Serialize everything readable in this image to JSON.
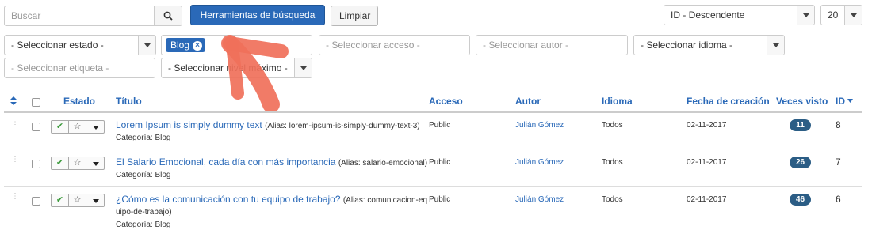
{
  "toolbar": {
    "search_placeholder": "Buscar",
    "search_tools_label": "Herramientas de búsqueda",
    "clear_label": "Limpiar",
    "ordering_value": "ID - Descendente",
    "limit_value": "20"
  },
  "filters": {
    "state_placeholder": "- Seleccionar estado -",
    "category_chip": "Blog",
    "access_placeholder": "- Seleccionar acceso -",
    "author_placeholder": "- Seleccionar autor -",
    "language_placeholder": "- Seleccionar idioma -",
    "tag_placeholder": "- Seleccionar etiqueta -",
    "level_placeholder": "- Seleccionar nivel máximo -"
  },
  "table": {
    "headers": {
      "status": "Estado",
      "title": "Título",
      "access": "Acceso",
      "author": "Autor",
      "language": "Idioma",
      "created": "Fecha de creación",
      "hits": "Veces visto",
      "id": "ID"
    },
    "rows": [
      {
        "title": "Lorem Ipsum is simply dummy text",
        "alias": "(Alias: lorem-ipsum-is-simply-dummy-text-3)",
        "category": "Categoría: Blog",
        "access": "Public",
        "author": "Julián Gómez",
        "language": "Todos",
        "created": "02-11-2017",
        "hits": "11",
        "id": "8"
      },
      {
        "title": "El Salario Emocional, cada día con más importancia",
        "alias": "(Alias: salario-emocional)",
        "category": "Categoría: Blog",
        "access": "Public",
        "author": "Julián Gómez",
        "language": "Todos",
        "created": "02-11-2017",
        "hits": "26",
        "id": "7"
      },
      {
        "title": "¿Cómo es la comunicación con tu equipo de trabajo?",
        "alias_line1": "(Alias: comunicacion-eq",
        "alias_line2": "uipo-de-trabajo)",
        "category": "Categoría: Blog",
        "access": "Public",
        "author": "Julián Gómez",
        "language": "Todos",
        "created": "02-11-2017",
        "hits": "46",
        "id": "6"
      }
    ]
  },
  "colors": {
    "primary": "#2a69b8",
    "annotation_arrow": "#f0705a",
    "badge": "#2b5d85"
  },
  "icons": [
    "search-icon",
    "sort-icon",
    "check-icon",
    "star-icon",
    "remove-icon"
  ]
}
